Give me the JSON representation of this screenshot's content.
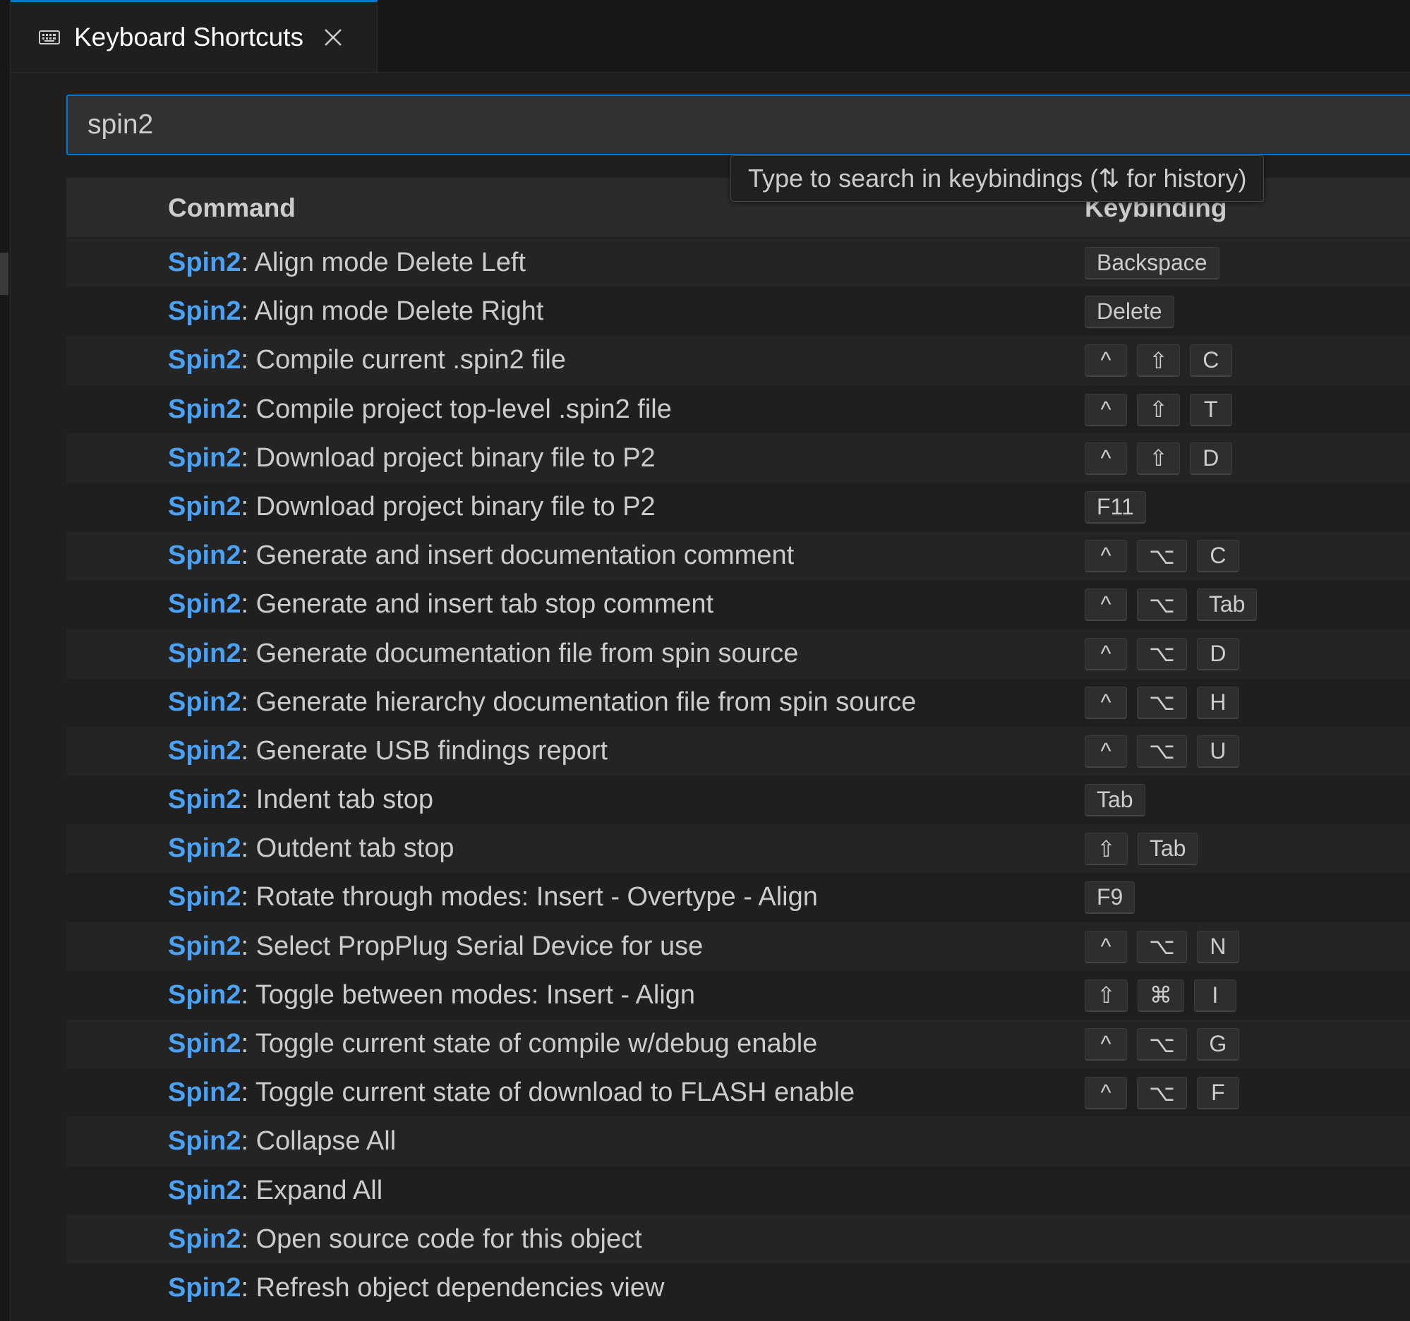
{
  "tab": {
    "label": "Keyboard Shortcuts",
    "icon": "keyboard-icon"
  },
  "search": {
    "value": "spin2"
  },
  "tooltip": {
    "text": "Type to search in keybindings (⇅ for history)"
  },
  "table": {
    "col_command": "Command",
    "col_keybinding": "Keybinding"
  },
  "rows": [
    {
      "ext": "Spin2",
      "sep": ": ",
      "title": "Align mode Delete Left",
      "keys": [
        "Backspace"
      ]
    },
    {
      "ext": "Spin2",
      "sep": ": ",
      "title": "Align mode Delete Right",
      "keys": [
        "Delete"
      ]
    },
    {
      "ext": "Spin2",
      "sep": ": ",
      "title": "Compile current .spin2 file",
      "keys": [
        "^",
        "⇧",
        "C"
      ]
    },
    {
      "ext": "Spin2",
      "sep": ": ",
      "title": "Compile project top-level .spin2 file",
      "keys": [
        "^",
        "⇧",
        "T"
      ]
    },
    {
      "ext": "Spin2",
      "sep": ": ",
      "title": "Download project binary file to P2",
      "keys": [
        "^",
        "⇧",
        "D"
      ]
    },
    {
      "ext": "Spin2",
      "sep": ": ",
      "title": "Download project binary file to P2",
      "keys": [
        "F11"
      ]
    },
    {
      "ext": "Spin2",
      "sep": ": ",
      "title": "Generate and insert documentation comment",
      "keys": [
        "^",
        "⌥",
        "C"
      ]
    },
    {
      "ext": "Spin2",
      "sep": ": ",
      "title": "Generate and insert tab stop comment",
      "keys": [
        "^",
        "⌥",
        "Tab"
      ]
    },
    {
      "ext": "Spin2",
      "sep": ": ",
      "title": "Generate documentation file from spin source",
      "keys": [
        "^",
        "⌥",
        "D"
      ]
    },
    {
      "ext": "Spin2",
      "sep": ": ",
      "title": "Generate hierarchy documentation file from spin source",
      "keys": [
        "^",
        "⌥",
        "H"
      ]
    },
    {
      "ext": "Spin2",
      "sep": ": ",
      "title": "Generate USB findings report",
      "keys": [
        "^",
        "⌥",
        "U"
      ]
    },
    {
      "ext": "Spin2",
      "sep": ": ",
      "title": "Indent tab stop",
      "keys": [
        "Tab"
      ]
    },
    {
      "ext": "Spin2",
      "sep": ": ",
      "title": "Outdent tab stop",
      "keys": [
        "⇧",
        "Tab"
      ]
    },
    {
      "ext": "Spin2",
      "sep": ": ",
      "title": "Rotate through modes: Insert - Overtype - Align",
      "keys": [
        "F9"
      ]
    },
    {
      "ext": "Spin2",
      "sep": ": ",
      "title": "Select PropPlug Serial Device for use",
      "keys": [
        "^",
        "⌥",
        "N"
      ]
    },
    {
      "ext": "Spin2",
      "sep": ": ",
      "title": "Toggle between modes: Insert - Align",
      "keys": [
        "⇧",
        "⌘",
        "I"
      ]
    },
    {
      "ext": "Spin2",
      "sep": ": ",
      "title": "Toggle current state of compile w/debug enable",
      "keys": [
        "^",
        "⌥",
        "G"
      ]
    },
    {
      "ext": "Spin2",
      "sep": ": ",
      "title": "Toggle current state of download to FLASH enable",
      "keys": [
        "^",
        "⌥",
        "F"
      ]
    },
    {
      "ext": "Spin2",
      "sep": ": ",
      "title": "Collapse All",
      "keys": []
    },
    {
      "ext": "Spin2",
      "sep": ": ",
      "title": "Expand All",
      "keys": []
    },
    {
      "ext": "Spin2",
      "sep": ": ",
      "title": "Open source code for this object",
      "keys": []
    },
    {
      "ext": "Spin2",
      "sep": ": ",
      "title": "Refresh object dependencies view",
      "keys": []
    }
  ],
  "colors": {
    "accent": "#0078d4",
    "extension_label": "#4ba2f5",
    "background": "#1f1f1f"
  }
}
